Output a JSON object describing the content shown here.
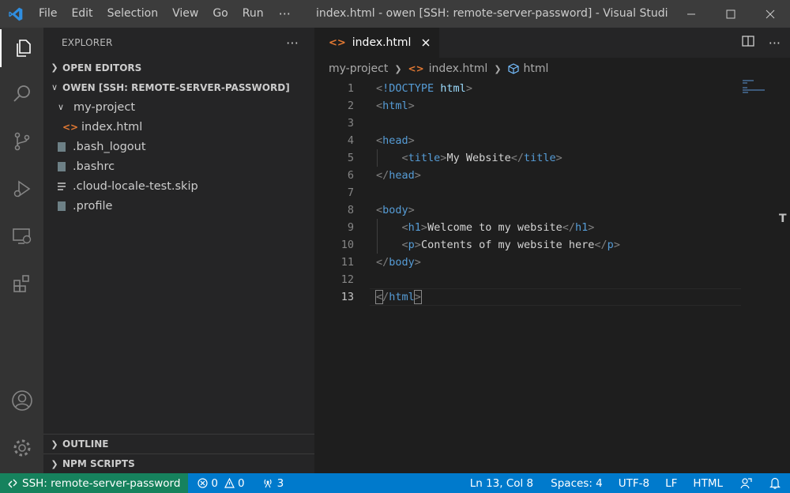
{
  "titlebar": {
    "menu": [
      "File",
      "Edit",
      "Selection",
      "View",
      "Go",
      "Run"
    ],
    "more": "···",
    "window_title": "index.html - owen [SSH: remote-server-password] - Visual Studio Co..."
  },
  "activitybar": {
    "items": [
      "explorer-icon",
      "search-icon",
      "source-control-icon",
      "run-debug-icon",
      "remote-explorer-icon",
      "extensions-icon",
      "accounts-icon",
      "manage-gear-icon"
    ]
  },
  "sidebar": {
    "title": "EXPLORER",
    "more": "···",
    "open_editors": "OPEN EDITORS",
    "workspace": "OWEN [SSH: REMOTE-SERVER-PASSWORD]",
    "tree": [
      {
        "label": "my-project",
        "kind": "folder"
      },
      {
        "label": "index.html",
        "kind": "html"
      },
      {
        "label": ".bash_logout",
        "kind": "file"
      },
      {
        "label": ".bashrc",
        "kind": "file"
      },
      {
        "label": ".cloud-locale-test.skip",
        "kind": "text"
      },
      {
        "label": ".profile",
        "kind": "file"
      }
    ],
    "outline": "OUTLINE",
    "npm_scripts": "NPM SCRIPTS"
  },
  "editor": {
    "tab": {
      "label": "index.html"
    },
    "breadcrumb": [
      "my-project",
      "index.html",
      "html"
    ],
    "current_line": 13,
    "lines": [
      "<!DOCTYPE html>",
      "<html>",
      "",
      "<head>",
      "    <title>My Website</title>",
      "</head>",
      "",
      "<body>",
      "    <h1>Welcome to my website</h1>",
      "    <p>Contents of my website here</p>",
      "</body>",
      "",
      "</html>"
    ]
  },
  "statusbar": {
    "remote": "SSH: remote-server-password",
    "errors": "0",
    "warnings": "0",
    "ports": "3",
    "position": "Ln 13, Col 8",
    "spaces": "Spaces: 4",
    "encoding": "UTF-8",
    "eol": "LF",
    "language": "HTML"
  },
  "colors": {
    "accent": "#007acc",
    "remote": "#16825d",
    "tag": "#569cd6",
    "html_icon": "#e37933"
  }
}
